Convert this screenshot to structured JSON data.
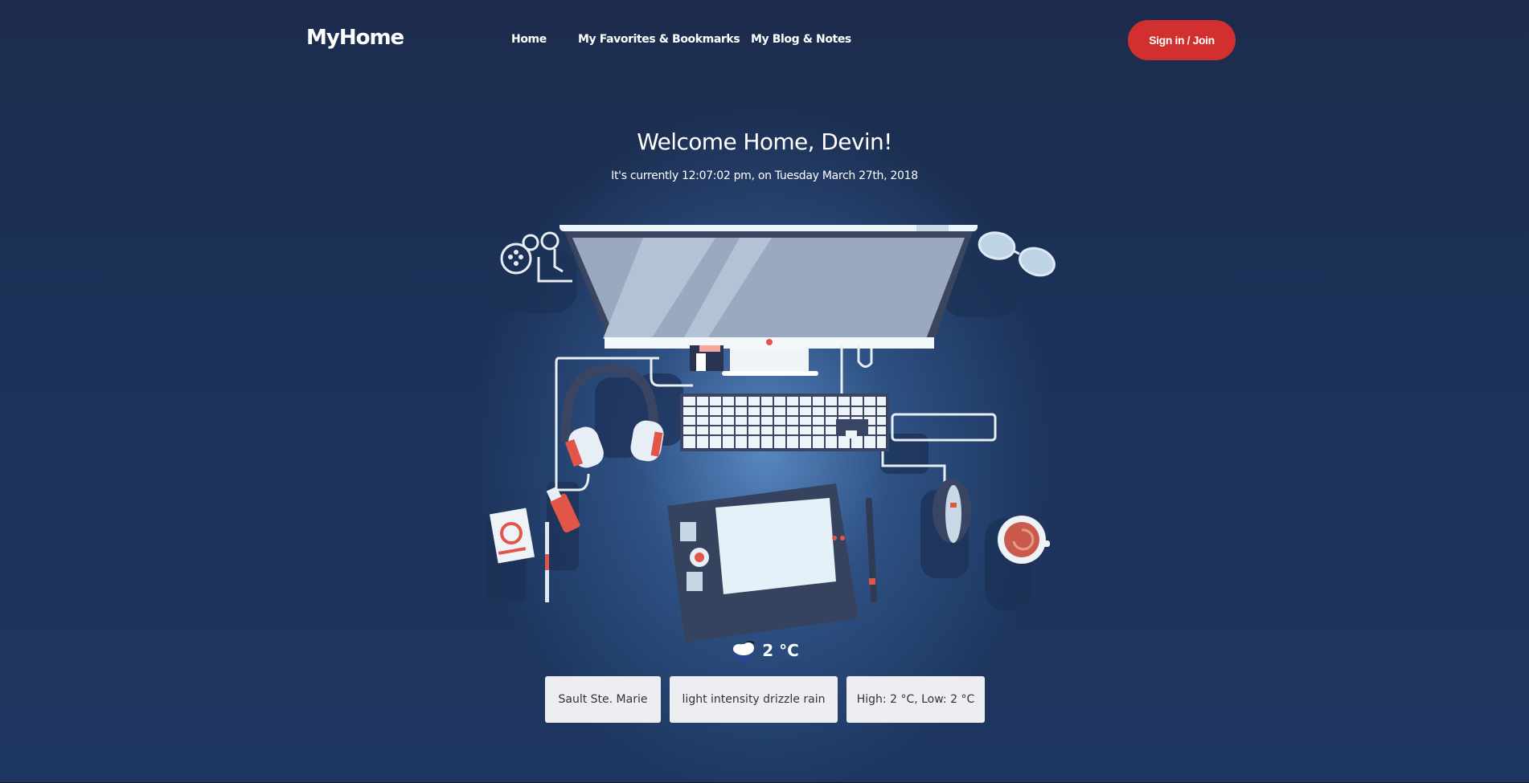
{
  "nav": {
    "logo": "MyHome",
    "links": [
      "Home",
      "My Favorites & Bookmarks",
      "My Blog & Notes"
    ],
    "signin_label": "Sign in / Join"
  },
  "hero": {
    "welcome": "Welcome Home, Devin!",
    "clock": "It's currently 12:07:02 pm, on Tuesday March 27th, 2018"
  },
  "weather": {
    "icon": "cloud-drizzle-icon",
    "temperature": "2 °C",
    "city": "Sault Ste. Marie",
    "description": "light intensity drizzle rain",
    "high_low": "High: 2 °C, Low: 2 °C"
  },
  "colors": {
    "accent": "#d1302f",
    "background": "#1d2c4d",
    "chip_bg": "#eceef2"
  }
}
